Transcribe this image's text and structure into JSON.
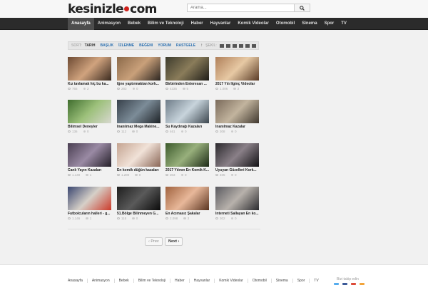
{
  "logo": {
    "part1": "kesinizle",
    "part2": "com"
  },
  "search": {
    "placeholder": "Arama..."
  },
  "nav": [
    "Anasayfa",
    "Animasyon",
    "Bebek",
    "Bilim ve Teknoloji",
    "Haber",
    "Hayvanlar",
    "Komik Videolar",
    "Otomobil",
    "Sinema",
    "Spor",
    "TV"
  ],
  "sort": {
    "label": "SORT:",
    "items": [
      "TARIH",
      "BAŞLIK",
      "İZLENME",
      "BEĞENI",
      "YORUM",
      "RASTGELE"
    ],
    "view_label": "ŞEKIL:"
  },
  "videos": [
    {
      "title": "Kız tavlamak hiç bu ka...",
      "views": "765",
      "comments": "2",
      "thumb": [
        "#6d4a33",
        "#d0a37e",
        "#3a2a1f"
      ]
    },
    {
      "title": "İğne yaptırmaktan kork...",
      "views": "283",
      "comments": "0",
      "thumb": [
        "#8b6a4a",
        "#c9a07a",
        "#2b2520"
      ]
    },
    {
      "title": "Birbirinden Enteresan ...",
      "views": "4335",
      "comments": "5",
      "thumb": [
        "#3d3b2c",
        "#8a7c5a",
        "#1f1d18"
      ]
    },
    {
      "title": "2017 Yılı İlginç Videolar",
      "views": "1.086",
      "comments": "2",
      "thumb": [
        "#b0805a",
        "#e7c9a4",
        "#5a3b26"
      ]
    },
    {
      "title": "Bilimsel Deneyler",
      "views": "136",
      "comments": "0",
      "thumb": [
        "#3f6d2e",
        "#9cc07a",
        "#d8d8d0"
      ]
    },
    {
      "title": "İnanılmaz Mega Makine...",
      "views": "112",
      "comments": "0",
      "thumb": [
        "#37404a",
        "#7c8c98",
        "#1d2226"
      ]
    },
    {
      "title": "Su Kaydırağı Kazaları",
      "views": "461",
      "comments": "0",
      "thumb": [
        "#6e7c88",
        "#c8d4dc",
        "#3c464e"
      ]
    },
    {
      "title": "İnanılmaz Kazalar",
      "views": "308",
      "comments": "0",
      "thumb": [
        "#7a6a5a",
        "#c2b49e",
        "#3f372e"
      ]
    },
    {
      "title": "Canlı Yayın Kazaları",
      "views": "1.140",
      "comments": "1",
      "thumb": [
        "#4a3f52",
        "#9a8aa4",
        "#241f28"
      ]
    },
    {
      "title": "En komik düğün kazaları",
      "views": "1.280",
      "comments": "0",
      "thumb": [
        "#c4a491",
        "#f1e2d8",
        "#8a6656"
      ]
    },
    {
      "title": "2017 Yılının En Komik K...",
      "views": "303",
      "comments": "0",
      "thumb": [
        "#3c5a2c",
        "#98b07c",
        "#1c2a16"
      ]
    },
    {
      "title": "Uyuyan Güzelleri Kork...",
      "views": "405",
      "comments": "0",
      "thumb": [
        "#2c2a2e",
        "#8a8088",
        "#121114"
      ]
    },
    {
      "title": "Futbolcuların halleri - g...",
      "views": "1.146",
      "comments": "1",
      "thumb": [
        "#3a4670",
        "#d6d0c8",
        "#cc3a2a"
      ]
    },
    {
      "title": "51.Bölge Bilinmeyen G...",
      "views": "115",
      "comments": "0",
      "thumb": [
        "#1e1e1e",
        "#5a5a5a",
        "#0a0a0a"
      ]
    },
    {
      "title": "En Acımasız Şakalar",
      "views": "2.098",
      "comments": "2",
      "thumb": [
        "#a0623e",
        "#e8b89a",
        "#5a3420"
      ]
    },
    {
      "title": "İnterneti Sallayan En ko...",
      "views": "302",
      "comments": "0",
      "thumb": [
        "#5a5a60",
        "#b8b2ac",
        "#2a2a2e"
      ]
    }
  ],
  "pagination": {
    "prev": "‹ Prev",
    "next": "Next ›"
  },
  "footer": {
    "nav": [
      "Anasayfa",
      "Animasyon",
      "Bebek",
      "Bilim ve Teknoloji",
      "Haber",
      "Hayvanlar",
      "Komik Videolar",
      "Otomobil",
      "Sinema",
      "Spor",
      "TV"
    ],
    "follow": "Bizi takip edin"
  },
  "colors": {
    "accent": "#d0211c",
    "nav_bg": "#2b2b2b",
    "link": "#2a6fb0"
  },
  "social_icons": [
    "twitter-icon",
    "facebook-icon",
    "google-plus-icon",
    "rss-icon"
  ]
}
